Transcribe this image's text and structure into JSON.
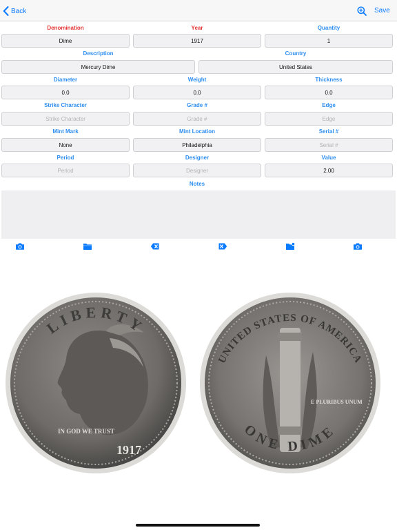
{
  "nav": {
    "back_label": "Back",
    "save_label": "Save"
  },
  "fields": {
    "denomination": {
      "label": "Denomination",
      "value": "Dime",
      "placeholder": ""
    },
    "year": {
      "label": "Year",
      "value": "1917",
      "placeholder": ""
    },
    "quantity": {
      "label": "Quantity",
      "value": "1",
      "placeholder": ""
    },
    "description": {
      "label": "Description",
      "value": "Mercury Dime",
      "placeholder": ""
    },
    "country": {
      "label": "Country",
      "value": "United States",
      "placeholder": ""
    },
    "diameter": {
      "label": "Diameter",
      "value": "0.0",
      "placeholder": ""
    },
    "weight": {
      "label": "Weight",
      "value": "0.0",
      "placeholder": ""
    },
    "thickness": {
      "label": "Thickness",
      "value": "0.0",
      "placeholder": ""
    },
    "strike_character": {
      "label": "Strike Character",
      "value": "",
      "placeholder": "Strike Character"
    },
    "grade": {
      "label": "Grade #",
      "value": "",
      "placeholder": "Grade #"
    },
    "edge": {
      "label": "Edge",
      "value": "",
      "placeholder": "Edge"
    },
    "mint_mark": {
      "label": "Mint Mark",
      "value": "None",
      "placeholder": ""
    },
    "mint_location": {
      "label": "Mint Location",
      "value": "Philadelphia",
      "placeholder": ""
    },
    "serial": {
      "label": "Serial #",
      "value": "",
      "placeholder": "Serial #"
    },
    "period": {
      "label": "Period",
      "value": "",
      "placeholder": "Period"
    },
    "designer": {
      "label": "Designer",
      "value": "",
      "placeholder": "Designer"
    },
    "value": {
      "label": "Value",
      "value": "2.00",
      "placeholder": ""
    },
    "notes": {
      "label": "Notes",
      "value": ""
    }
  },
  "coins": {
    "obverse": {
      "legend_top": "LIBERTY",
      "motto": "IN GOD WE TRUST",
      "date": "1917"
    },
    "reverse": {
      "legend_top": "UNITED STATES OF AMERICA",
      "legend_bottom": "ONE DIME",
      "motto": "E PLURIBUS UNUM"
    }
  },
  "colors": {
    "accent": "#0a7aff",
    "label_blue": "#2d8ef0",
    "label_required": "#e53535"
  }
}
